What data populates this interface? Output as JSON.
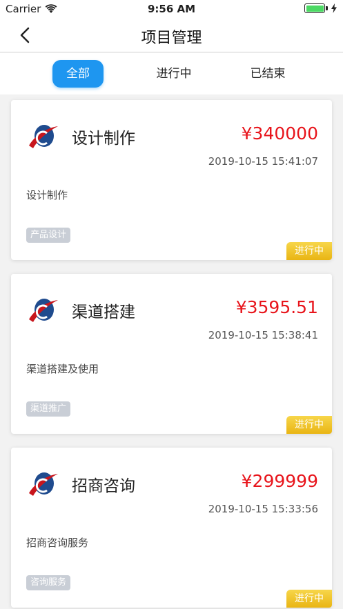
{
  "status_bar": {
    "carrier": "Carrier",
    "time": "9:56 AM"
  },
  "nav": {
    "title": "项目管理"
  },
  "tabs": [
    {
      "label": "全部",
      "active": true
    },
    {
      "label": "进行中",
      "active": false
    },
    {
      "label": "已结束",
      "active": false
    }
  ],
  "projects": [
    {
      "title": "设计制作",
      "price": "¥340000",
      "time": "2019-10-15 15:41:07",
      "desc": "设计制作",
      "tag": "产品设计",
      "status": "进行中"
    },
    {
      "title": "渠道搭建",
      "price": "¥3595.51",
      "time": "2019-10-15 15:38:41",
      "desc": "渠道搭建及使用",
      "tag": "渠道推广",
      "status": "进行中"
    },
    {
      "title": "招商咨询",
      "price": "¥299999",
      "time": "2019-10-15 15:33:56",
      "desc": "招商咨询服务",
      "tag": "咨询服务",
      "status": "进行中"
    }
  ],
  "colors": {
    "accent": "#1e96f0",
    "price": "#e8141b",
    "status": "#f0c52a",
    "tag": "#c9ced6"
  }
}
